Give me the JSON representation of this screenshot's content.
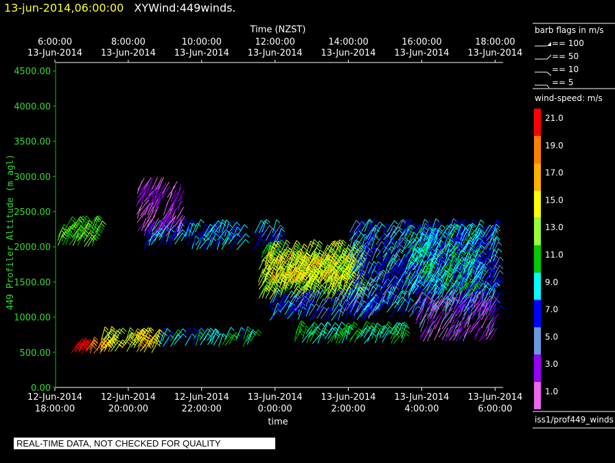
{
  "header": {
    "datetime": "13-jun-2014,06:00:00",
    "product": "XYWind:449winds."
  },
  "banner": "REAL-TIME DATA, NOT CHECKED FOR QUALITY",
  "legend": {
    "barb_title": "barb flags in m/s",
    "barb_items": [
      "== 100",
      "== 50",
      "== 10",
      "== 5"
    ],
    "speed_title": "wind-speed: m/s",
    "colorbar": [
      {
        "label": "21.0",
        "color": "#ff0000"
      },
      {
        "label": "19.0",
        "color": "#ff8000"
      },
      {
        "label": "17.0",
        "color": "#ffb000"
      },
      {
        "label": "15.0",
        "color": "#ffff00"
      },
      {
        "label": "13.0",
        "color": "#99ff33"
      },
      {
        "label": "11.0",
        "color": "#00cc00"
      },
      {
        "label": "9.0",
        "color": "#00ffff"
      },
      {
        "label": "7.0",
        "color": "#0000ff"
      },
      {
        "label": "5.0",
        "color": "#6699dd"
      },
      {
        "label": "3.0",
        "color": "#9900ff"
      },
      {
        "label": "1.0",
        "color": "#ee66ee"
      }
    ],
    "source": "iss1/prof449_winds"
  },
  "chart_data": {
    "type": "scatter",
    "title": "",
    "top_axis_label": "Time (NZST)",
    "top_ticks": [
      {
        "time": "6:00:00",
        "date": "13-Jun-2014"
      },
      {
        "time": "8:00:00",
        "date": "13-Jun-2014"
      },
      {
        "time": "10:00:00",
        "date": "13-Jun-2014"
      },
      {
        "time": "12:00:00",
        "date": "13-Jun-2014"
      },
      {
        "time": "14:00:00",
        "date": "13-Jun-2014"
      },
      {
        "time": "16:00:00",
        "date": "13-Jun-2014"
      },
      {
        "time": "18:00:00",
        "date": "13-Jun-2014"
      }
    ],
    "xlabel": "time",
    "x_ticks": [
      {
        "date": "12-Jun-2014",
        "time": "18:00:00"
      },
      {
        "date": "12-Jun-2014",
        "time": "20:00:00"
      },
      {
        "date": "12-Jun-2014",
        "time": "22:00:00"
      },
      {
        "date": "13-Jun-2014",
        "time": "0:00:00"
      },
      {
        "date": "13-Jun-2014",
        "time": "2:00:00"
      },
      {
        "date": "13-Jun-2014",
        "time": "4:00:00"
      },
      {
        "date": "13-Jun-2014",
        "time": "6:00:00"
      }
    ],
    "x_range_hours": [
      -6,
      6.2
    ],
    "ylabel": "449 Profiler Altitude (m agl)",
    "ylim": [
      0,
      4600
    ],
    "y_ticks": [
      "0.00",
      "500.00",
      "1000.00",
      "1500.00",
      "2000.00",
      "2500.00",
      "3000.00",
      "3500.00",
      "4000.00",
      "4500.00"
    ],
    "barb_groups": [
      {
        "t0": -5.95,
        "t1": -4.85,
        "alt0": 2000,
        "alt1": 2300,
        "speed": 12
      },
      {
        "t0": -5.6,
        "t1": -4.7,
        "alt0": 480,
        "alt1": 560,
        "speed": 20
      },
      {
        "t0": -4.8,
        "t1": -3.2,
        "alt0": 490,
        "alt1": 720,
        "speed": 15
      },
      {
        "t0": -3.2,
        "t1": -0.6,
        "alt0": 580,
        "alt1": 720,
        "speed": 9
      },
      {
        "t0": -3.6,
        "t1": -1.0,
        "alt0": 1950,
        "alt1": 2250,
        "speed": 8
      },
      {
        "t0": -3.8,
        "t1": -2.6,
        "alt0": 2150,
        "alt1": 2850,
        "speed": 2
      },
      {
        "t0": -0.6,
        "t1": 0.1,
        "alt0": 1950,
        "alt1": 2250,
        "speed": 7
      },
      {
        "t0": -0.5,
        "t1": 2.3,
        "alt0": 1250,
        "alt1": 1950,
        "speed": 13
      },
      {
        "t0": -0.3,
        "t1": 2.0,
        "alt0": 1400,
        "alt1": 1800,
        "speed": 15
      },
      {
        "t0": -0.2,
        "t1": 3.0,
        "alt0": 950,
        "alt1": 1250,
        "speed": 7
      },
      {
        "t0": 2.0,
        "t1": 6.0,
        "alt0": 1000,
        "alt1": 2250,
        "speed": 7
      },
      {
        "t0": 3.5,
        "t1": 5.5,
        "alt0": 1300,
        "alt1": 2200,
        "speed": 9
      },
      {
        "t0": 0.5,
        "t1": 3.5,
        "alt0": 620,
        "alt1": 800,
        "speed": 10
      },
      {
        "t0": 3.8,
        "t1": 5.9,
        "alt0": 650,
        "alt1": 1250,
        "speed": 3
      }
    ]
  }
}
